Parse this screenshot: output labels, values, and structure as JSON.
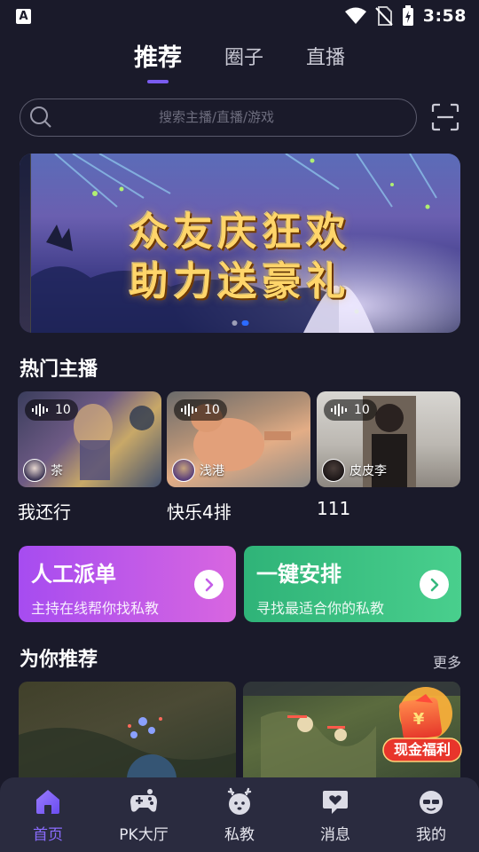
{
  "status_bar": {
    "time": "3:58",
    "app_letter": "A"
  },
  "top_tabs": [
    {
      "label": "推荐",
      "active": true
    },
    {
      "label": "圈子",
      "active": false
    },
    {
      "label": "直播",
      "active": false
    }
  ],
  "search": {
    "placeholder": "搜索主播/直播/游戏",
    "value": ""
  },
  "banner": {
    "line1": "众友庆狂欢",
    "line2": "助力送豪礼",
    "slide_count": 2,
    "active_slide": 2
  },
  "hot_anchors": {
    "title": "热门主播",
    "items": [
      {
        "title": "我还行",
        "nickname": "茶",
        "viewers": "10"
      },
      {
        "title": "快乐4排",
        "nickname": "浅港",
        "viewers": "10"
      },
      {
        "title": "111",
        "nickname": "皮皮李",
        "viewers": "10"
      }
    ]
  },
  "actions": [
    {
      "title": "人工派单",
      "subtitle": "主持在线帮你找私教",
      "color_from": "#a64cf0",
      "color_to": "#d866e0"
    },
    {
      "title": "一键安排",
      "subtitle": "寻找最适合你的私教",
      "color_from": "#2fb378",
      "color_to": "#49cf8d"
    }
  ],
  "recommend": {
    "title": "为你推荐",
    "more": "更多"
  },
  "cash_welfare": {
    "label": "现金福利"
  },
  "bottom_nav": [
    {
      "label": "首页",
      "icon": "home-icon",
      "active": true
    },
    {
      "label": "PK大厅",
      "icon": "gamepad-icon",
      "active": false
    },
    {
      "label": "私教",
      "icon": "deer-icon",
      "active": false
    },
    {
      "label": "消息",
      "icon": "message-icon",
      "active": false
    },
    {
      "label": "我的",
      "icon": "profile-icon",
      "active": false
    }
  ],
  "colors": {
    "accent": "#7a5cf0",
    "background": "#1a1a2a",
    "nav_bg": "#2a2b3f"
  }
}
